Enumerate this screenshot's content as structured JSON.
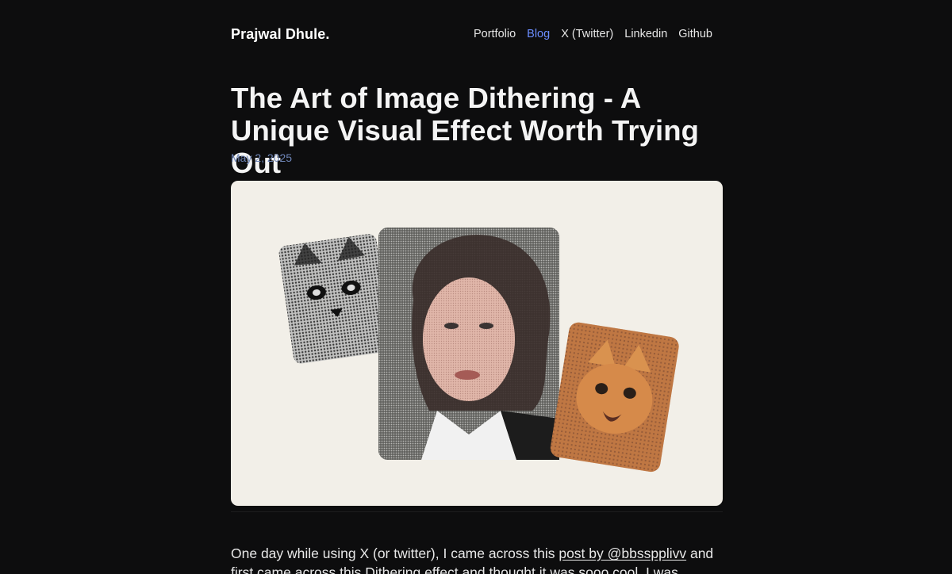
{
  "header": {
    "logo": "Prajwal Dhule.",
    "nav": [
      {
        "label": "Portfolio",
        "active": false
      },
      {
        "label": "Blog",
        "active": true
      },
      {
        "label": "X (Twitter)",
        "active": false
      },
      {
        "label": "Linkedin",
        "active": false
      },
      {
        "label": "Github",
        "active": false
      }
    ]
  },
  "article": {
    "title": "The Art of Image Dithering - A Unique Visual Effect Worth Trying Out",
    "date": "May 2, 2025",
    "intro_before_link": "One day while using X (or twitter), I came across this ",
    "intro_link": "post by @bbsspplivv",
    "intro_after_link": " and first came across this Dithering effect and thought it was sooo cool. I was fascinated as I"
  },
  "hero": {
    "images": [
      "dithered-cat-grayscale",
      "dithered-portrait-woman",
      "dithered-cat-orange"
    ]
  },
  "colors": {
    "background": "#0d0d0e",
    "accent": "#6b8dff",
    "date": "#6f86b8",
    "hero_bg": "#f2efe8"
  }
}
